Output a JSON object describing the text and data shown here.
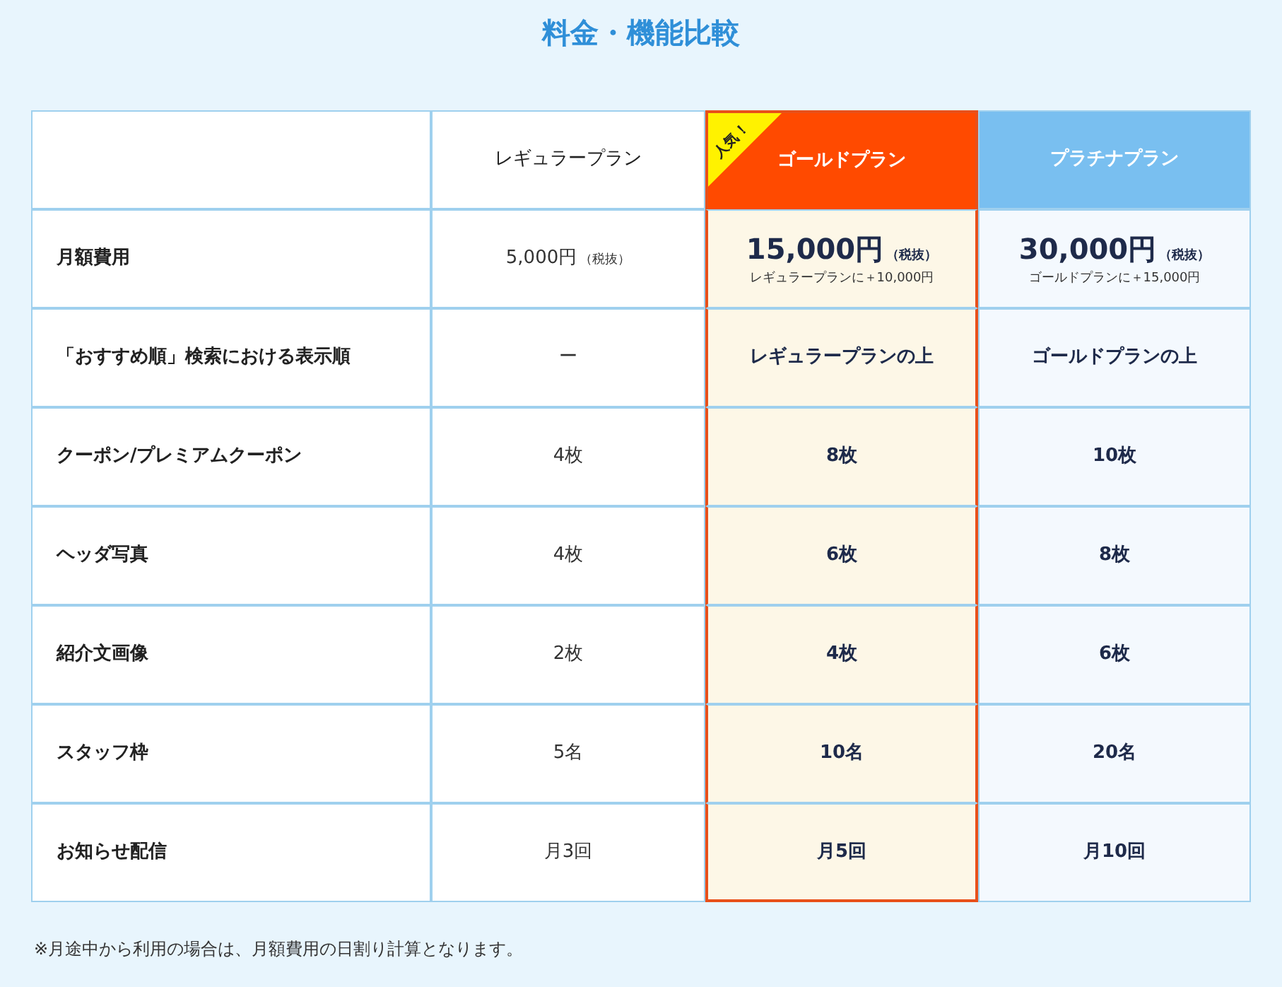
{
  "title": "料金・機能比較",
  "plans": [
    {
      "name": "レギュラープラン",
      "kind": "regular"
    },
    {
      "name": "ゴールドプラン",
      "kind": "gold",
      "badge": "人気！"
    },
    {
      "name": "プラチナプラン",
      "kind": "platinum"
    }
  ],
  "rows": [
    {
      "label": "月額費用",
      "cells": [
        {
          "value": "5,000円",
          "tax": "（税抜）"
        },
        {
          "value": "15,000円",
          "tax": "（税抜）",
          "note": "レギュラープランに＋10,000円"
        },
        {
          "value": "30,000円",
          "tax": "（税抜）",
          "note": "ゴールドプランに＋15,000円"
        }
      ]
    },
    {
      "label": "「おすすめ順」検索における表示順",
      "cells": [
        {
          "value": "ー"
        },
        {
          "value": "レギュラープランの上"
        },
        {
          "value": "ゴールドプランの上"
        }
      ]
    },
    {
      "label": "クーポン/プレミアムクーポン",
      "cells": [
        {
          "value": "4枚"
        },
        {
          "value": "8枚"
        },
        {
          "value": "10枚"
        }
      ]
    },
    {
      "label": "ヘッダ写真",
      "cells": [
        {
          "value": "4枚"
        },
        {
          "value": "6枚"
        },
        {
          "value": "8枚"
        }
      ]
    },
    {
      "label": "紹介文画像",
      "cells": [
        {
          "value": "2枚"
        },
        {
          "value": "4枚"
        },
        {
          "value": "6枚"
        }
      ]
    },
    {
      "label": "スタッフ枠",
      "cells": [
        {
          "value": "5名"
        },
        {
          "value": "10名"
        },
        {
          "value": "20名"
        }
      ]
    },
    {
      "label": "お知らせ配信",
      "cells": [
        {
          "value": "月3回"
        },
        {
          "value": "月5回"
        },
        {
          "value": "月10回"
        }
      ]
    }
  ],
  "footnote": "※月途中から利用の場合は、月額費用の日割り計算となります。"
}
